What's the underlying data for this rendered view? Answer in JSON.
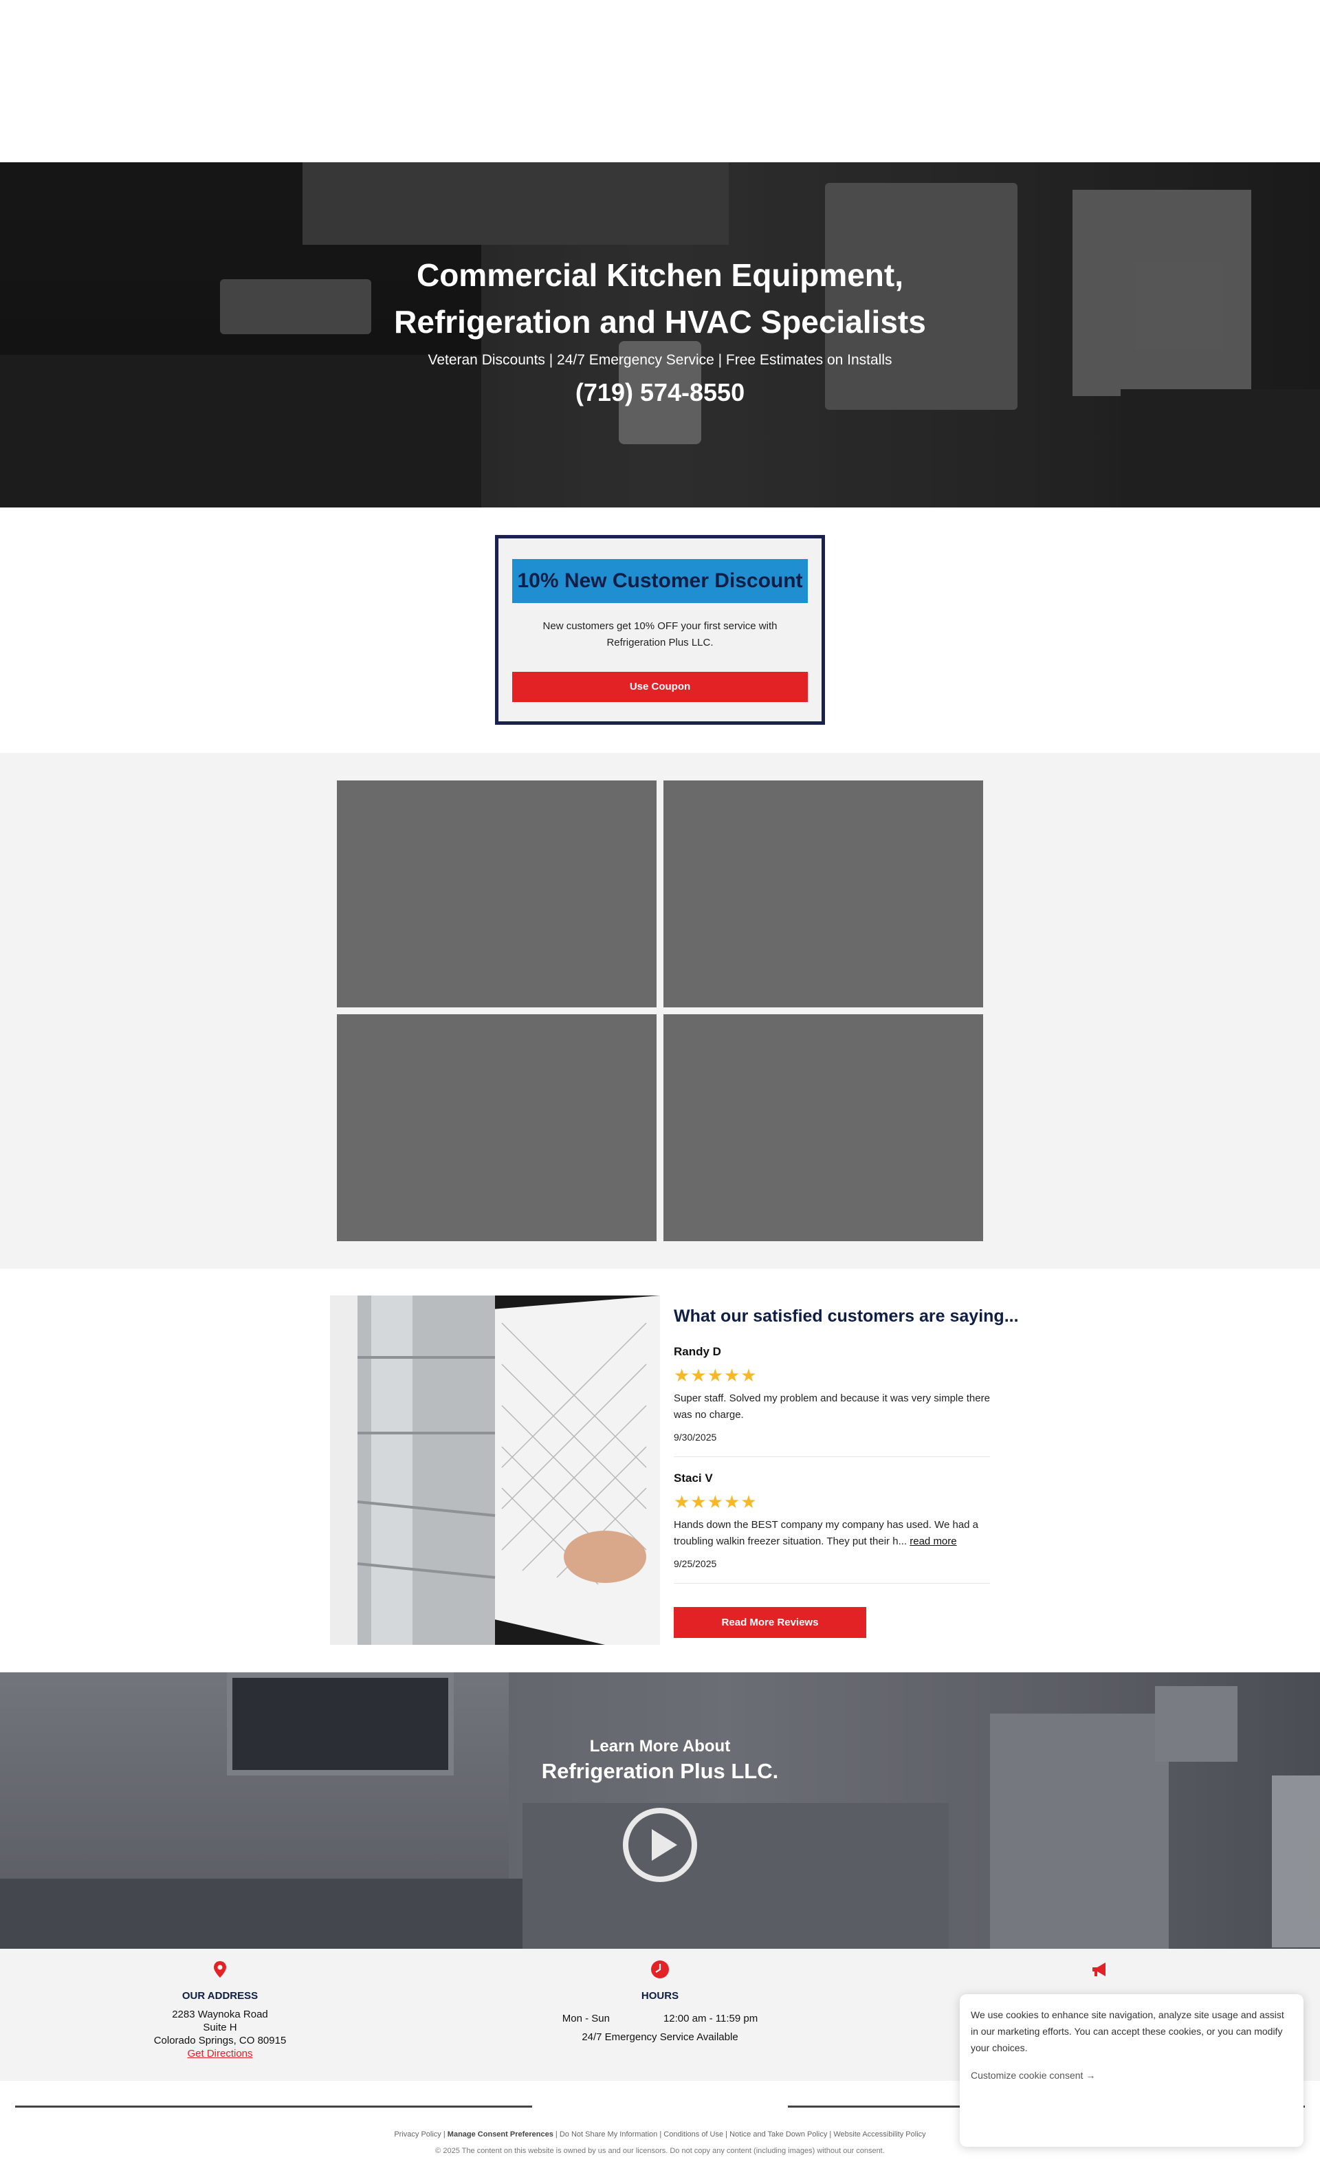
{
  "hero": {
    "title_line1": "Commercial Kitchen Equipment,",
    "title_line2": "Refrigeration and HVAC Specialists",
    "subtitle": "Veteran Discounts | 24/7 Emergency Service | Free Estimates on Installs",
    "phone": "(719) 574-8550"
  },
  "coupon": {
    "title": "10% New Customer Discount",
    "text_line1": "New customers get 10% OFF your first service with",
    "text_line2": "Refrigeration Plus LLC.",
    "button": "Use Coupon"
  },
  "reviews": {
    "heading": "What our satisfied customers are saying...",
    "items": [
      {
        "name": "Randy D",
        "stars": "★★★★★",
        "text": "Super staff. Solved my problem and because it was very simple there was no charge.",
        "read_more": "",
        "date": "9/30/2025"
      },
      {
        "name": "Staci V",
        "stars": "★★★★★",
        "text": "Hands down the BEST company my company has used. We had a troubling walkin freezer situation. They put their h...",
        "read_more": "read more",
        "date": "9/25/2025"
      }
    ],
    "button": "Read More Reviews"
  },
  "video": {
    "kicker": "Learn More About",
    "title": "Refrigeration Plus LLC."
  },
  "info": {
    "address": {
      "heading": "OUR ADDRESS",
      "line1": "2283 Waynoka Road",
      "line2": "Suite H",
      "line3": "Colorado Springs, CO 80915",
      "link": "Get Directions",
      "icon": "map-pin-icon"
    },
    "hours": {
      "heading": "HOURS",
      "days": "Mon - Sun",
      "time": "12:00 am - 11:59 pm",
      "note": "24/7 Emergency Service Available",
      "icon": "clock-icon"
    },
    "contact": {
      "icon": "megaphone-icon"
    }
  },
  "footer": {
    "links": [
      "Privacy Policy",
      "Manage Consent Preferences",
      "Do Not Share My Information",
      "Conditions of Use",
      "Notice and Take Down Policy",
      "Website Accessibility Policy"
    ],
    "copyright": "© 2025 The content on this website is owned by us and our licensors. Do not copy any content (including images) without our consent."
  },
  "cookie": {
    "text": "We use cookies to enhance site navigation, analyze site usage and assist in our marketing efforts. You can accept these cookies, or you can modify your choices.",
    "link": "Customize cookie consent"
  },
  "colors": {
    "navy": "#0f1e45",
    "accent_blue": "#1f8fd1",
    "red": "#e32226",
    "star": "#f7b826"
  }
}
